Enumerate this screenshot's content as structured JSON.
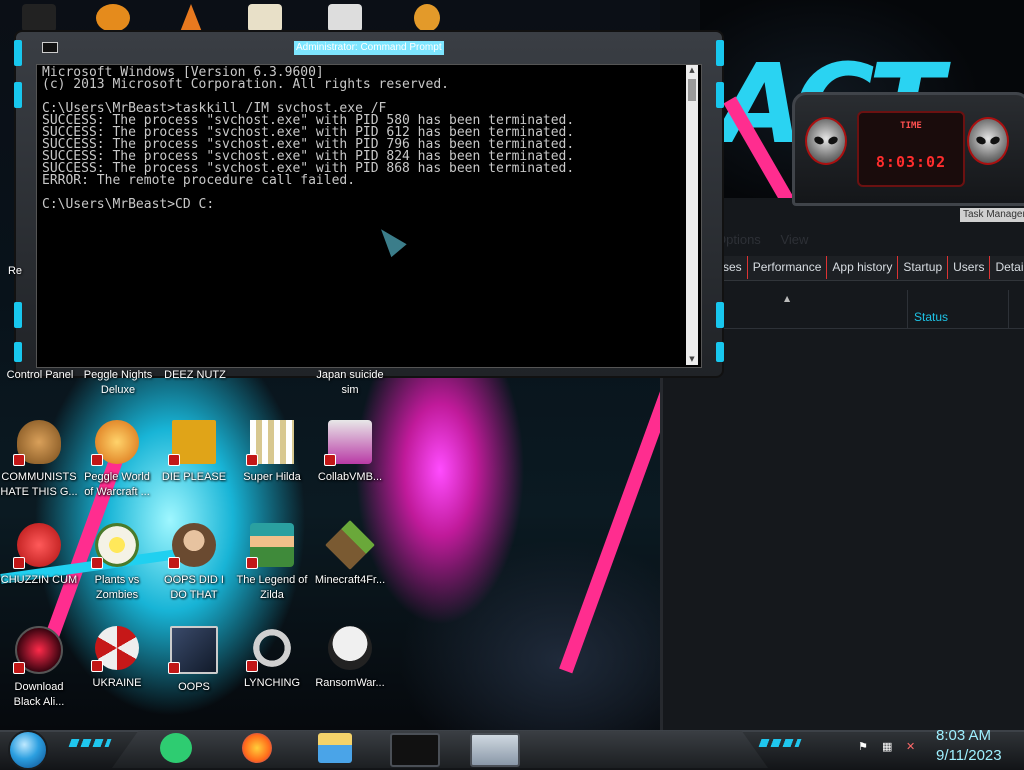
{
  "cmd_window": {
    "title": "Administrator: Command Prompt",
    "lines": [
      "Microsoft Windows [Version 6.3.9600]",
      "(c) 2013 Microsoft Corporation. All rights reserved.",
      "",
      "C:\\Users\\MrBeast>taskkill /IM svchost.exe /F",
      "SUCCESS: The process \"svchost.exe\" with PID 580 has been terminated.",
      "SUCCESS: The process \"svchost.exe\" with PID 612 has been terminated.",
      "SUCCESS: The process \"svchost.exe\" with PID 796 has been terminated.",
      "SUCCESS: The process \"svchost.exe\" with PID 824 has been terminated.",
      "SUCCESS: The process \"svchost.exe\" with PID 868 has been terminated.",
      "ERROR: The remote procedure call failed.",
      "",
      "C:\\Users\\MrBeast>CD C:"
    ]
  },
  "task_manager": {
    "title": "Task Manager",
    "menu": [
      "Options",
      "View"
    ],
    "tabs": [
      "sses",
      "Performance",
      "App history",
      "Startup",
      "Users",
      "Details"
    ],
    "column_status": "Status"
  },
  "clock_gadget": {
    "label": "TIME",
    "time": "8:03:02"
  },
  "desktop": {
    "partial_labels": [
      "Control Panel",
      "Peggle Nights Deluxe",
      "DEEZ NUTZ",
      "Japan suicide sim",
      "Re"
    ],
    "icons_row1": [
      {
        "label": "COMMUNISTS HATE THIS G...",
        "icon": "money-bag-icon",
        "color": "#b07a3a"
      },
      {
        "label": "Peggle World of Warcraft ...",
        "icon": "peggle-icon",
        "color": "#e38a1d"
      },
      {
        "label": "DIE PLEASE",
        "icon": "de-logo-icon",
        "color": "#e0a418"
      },
      {
        "label": "Super Hilda",
        "icon": "pixel-character-icon",
        "color": "#d8c890"
      },
      {
        "label": "CollabVMB...",
        "icon": "monitor-icon",
        "color": "#b93aa6"
      }
    ],
    "icons_row2": [
      {
        "label": "CHUZZIN CUM",
        "icon": "chuzzle-icon",
        "color": "#e22a2a"
      },
      {
        "label": "Plants vs Zombies",
        "icon": "flower-icon",
        "color": "#e9e7d8"
      },
      {
        "label": "OOPS DID I DO THAT",
        "icon": "portrait-icon",
        "color": "#8a6a4c"
      },
      {
        "label": "The Legend of Zilda",
        "icon": "zelda-icon",
        "color": "#3f8a3a"
      },
      {
        "label": "Minecraft4Fr...",
        "icon": "grass-block-icon",
        "color": "#5a8a32"
      }
    ],
    "icons_row3": [
      {
        "label": "Download Black Ali...",
        "icon": "alien-orb-icon",
        "color": "#5a0a1a"
      },
      {
        "label": "UKRAINE",
        "icon": "radiation-icon",
        "color": "#c61818"
      },
      {
        "label": "OOPS",
        "icon": "photo-icon",
        "color": "#24324a"
      },
      {
        "label": "LYNCHING",
        "icon": "noose-icon",
        "color": "#cfcfcf"
      },
      {
        "label": "RansomWar...",
        "icon": "skull-icon",
        "color": "#dcdcdc"
      }
    ]
  },
  "taskbar": {
    "time": "8:03 AM",
    "date": "9/11/2023",
    "apps": [
      "messages-app-icon",
      "firefox-icon",
      "file-explorer-icon",
      "command-prompt-icon",
      "task-manager-icon"
    ]
  }
}
